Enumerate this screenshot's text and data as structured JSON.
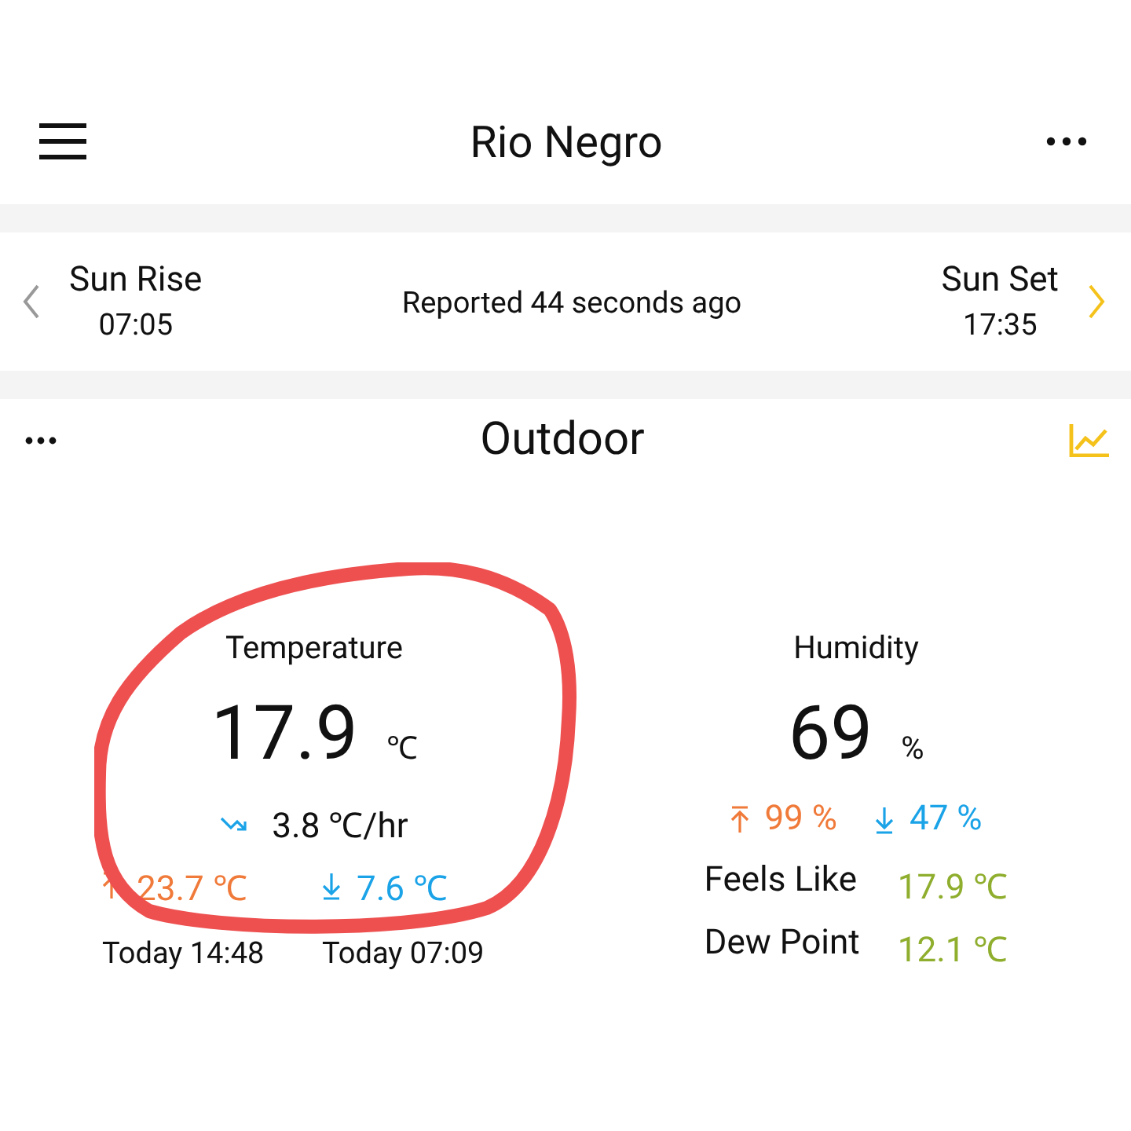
{
  "header": {
    "title": "Rio Negro"
  },
  "sun": {
    "rise_label": "Sun Rise",
    "rise_time": "07:05",
    "reported": "Reported 44 seconds ago",
    "set_label": "Sun Set",
    "set_time": "17:35"
  },
  "section": {
    "title": "Outdoor"
  },
  "temperature": {
    "label": "Temperature",
    "value": "17.9",
    "unit": "℃",
    "rate": "3.8 ℃/hr",
    "high": "23.7 ℃",
    "low": "7.6 ℃",
    "high_time": "Today 14:48",
    "low_time": "Today 07:09"
  },
  "humidity": {
    "label": "Humidity",
    "value": "69",
    "unit": "%",
    "high": "99 %",
    "low": "47 %",
    "details": [
      {
        "label": "Feels Like",
        "value": "17.9 ℃"
      },
      {
        "label": "Dew Point",
        "value": "12.1 ℃"
      }
    ]
  },
  "annotation": {
    "kind": "circle",
    "color": "#ee5050"
  }
}
